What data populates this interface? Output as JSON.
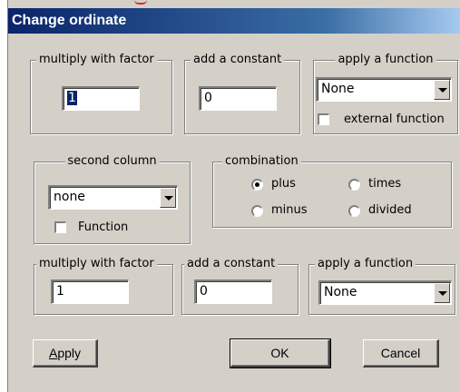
{
  "window": {
    "title": "Change ordinate"
  },
  "row1": {
    "multiply": {
      "legend": "multiply with factor",
      "value": "1"
    },
    "constant": {
      "legend": "add a constant",
      "value": "0"
    },
    "function": {
      "legend": "apply a  function",
      "selected": "None",
      "checkbox_label": "external function",
      "checked": false
    }
  },
  "second_column": {
    "legend": "second column",
    "selected": "none",
    "checkbox_label": "Function",
    "checked": false
  },
  "combination": {
    "legend": "combination",
    "options": [
      "plus",
      "times",
      "minus",
      "divided"
    ],
    "selected": "plus"
  },
  "row3": {
    "multiply": {
      "legend": "multiply with factor",
      "value": "1"
    },
    "constant": {
      "legend": "add a constant",
      "value": "0"
    },
    "function": {
      "legend": "apply a function",
      "selected": "None"
    }
  },
  "buttons": {
    "apply_first": "A",
    "apply_rest": "pply",
    "ok": "OK",
    "cancel": "Cancel"
  }
}
